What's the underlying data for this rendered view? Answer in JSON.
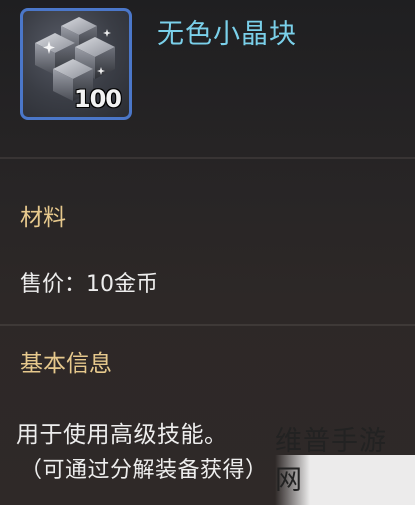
{
  "item": {
    "name": "无色小晶块",
    "quantity": "100",
    "icon": "crystal-cube-icon",
    "rarity_color": "#4b77c9"
  },
  "sections": {
    "type_title": "材料",
    "price_label": "售价：10金币",
    "info_title": "基本信息",
    "description": "用于使用高级技能。",
    "note": "（可通过分解装备获得）"
  },
  "watermark": "维普手游网",
  "colors": {
    "name": "#7ad0ea",
    "section_title": "#e7c98d",
    "body_text": "#ededed"
  }
}
